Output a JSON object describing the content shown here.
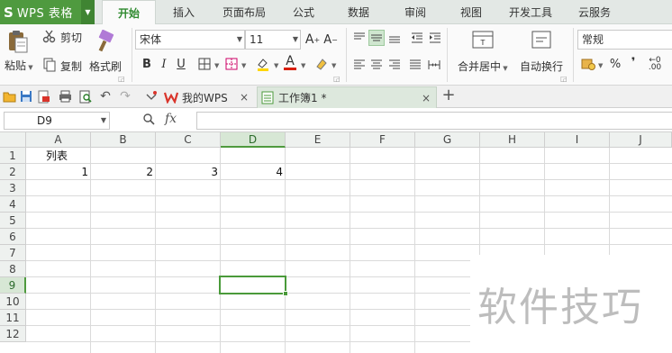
{
  "app": {
    "logo_glyph": "S",
    "name": "WPS 表格",
    "brand_color": "#4f9a3f"
  },
  "menu": {
    "items": [
      "开始",
      "插入",
      "页面布局",
      "公式",
      "数据",
      "审阅",
      "视图",
      "开发工具",
      "云服务"
    ],
    "active": "开始"
  },
  "ribbon": {
    "paste_label": "粘贴",
    "cut_label": "剪切",
    "copy_label": "复制",
    "format_painter_label": "格式刷",
    "font_name": "宋体",
    "font_size": "11",
    "grow_font": "A⁺",
    "shrink_font": "A⁻",
    "bold": "B",
    "italic": "I",
    "underline": "U",
    "font_color_glyph": "A",
    "merge_center_label": "合并居中",
    "wrap_text_label": "自动换行",
    "number_format": "常规",
    "percent": "%",
    "comma": "❜",
    "accent_font_color": "#d81e06",
    "highlight_color": "#ffd600"
  },
  "quickbar": {
    "tabs": [
      {
        "label": "我的WPS",
        "close": "×"
      },
      {
        "label": "工作簿1 *",
        "close": "×"
      }
    ],
    "new_tab": "+"
  },
  "formula_bar": {
    "cell_ref": "D9",
    "fx": "fx",
    "value": ""
  },
  "sheet": {
    "columns": [
      "A",
      "B",
      "C",
      "D",
      "E",
      "F",
      "G",
      "H",
      "I",
      "J"
    ],
    "rows": [
      "1",
      "2",
      "3",
      "4",
      "5",
      "6",
      "7",
      "8",
      "9",
      "10",
      "11",
      "12"
    ],
    "selected_column": "D",
    "selected_row": "9",
    "cells": {
      "A1": "列表",
      "A2": "1",
      "B2": "2",
      "C2": "3",
      "D2": "4"
    }
  },
  "watermark": "软件技巧"
}
